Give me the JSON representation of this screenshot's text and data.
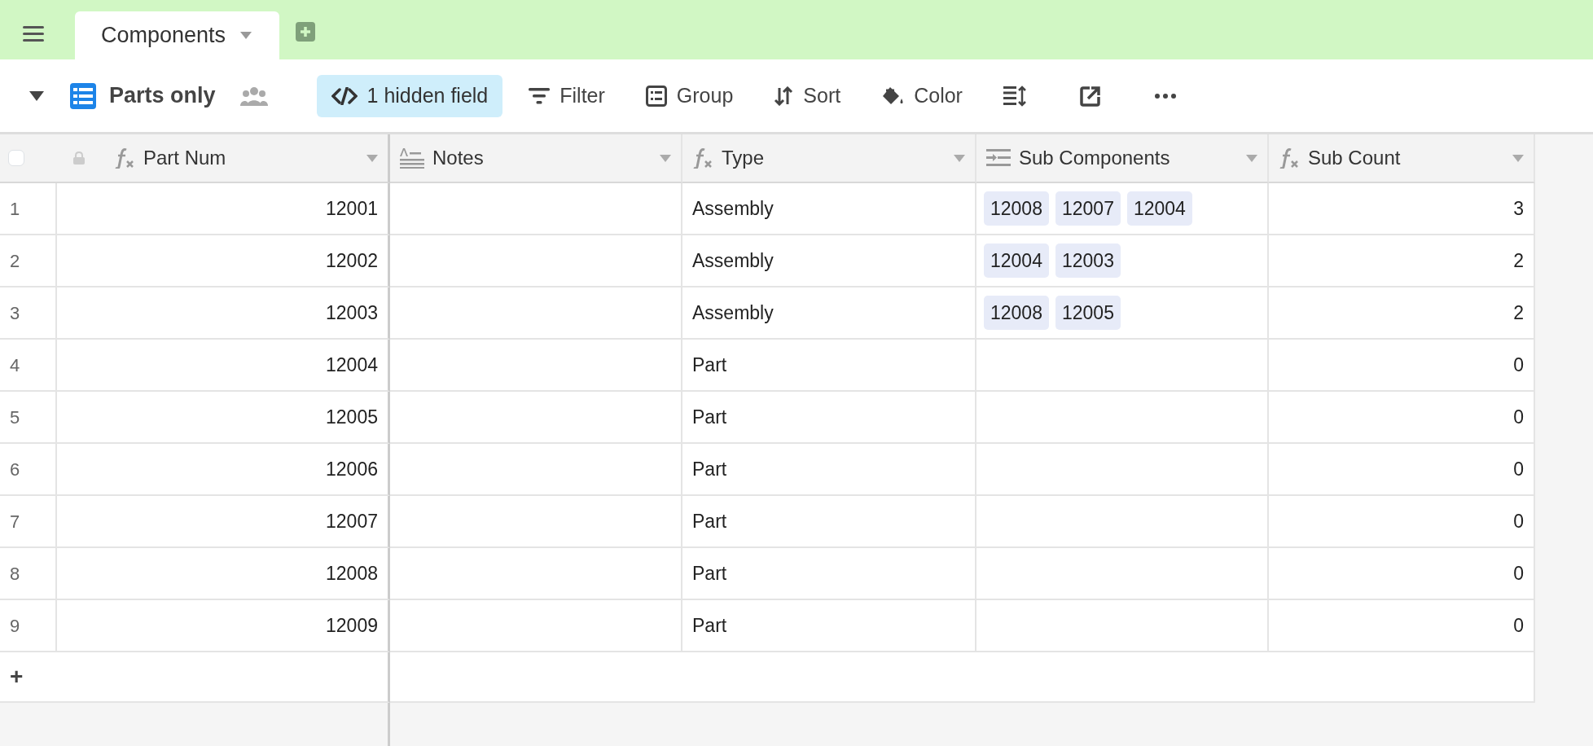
{
  "tabs": [
    {
      "label": "Components",
      "selected": true
    }
  ],
  "view": {
    "name": "Parts only"
  },
  "toolbar": [
    {
      "kind": "hidden",
      "label": "1 hidden field",
      "active": true
    },
    {
      "kind": "filter",
      "label": "Filter",
      "active": false
    },
    {
      "kind": "group",
      "label": "Group",
      "active": false
    },
    {
      "kind": "sort",
      "label": "Sort",
      "active": false
    },
    {
      "kind": "color",
      "label": "Color",
      "active": false
    },
    {
      "kind": "rowheight",
      "active": false
    },
    {
      "kind": "share",
      "active": false
    },
    {
      "kind": "more",
      "active": false
    }
  ],
  "table": {
    "select_all": {
      "checked": false
    },
    "columns": [
      {
        "name": "Part Num",
        "kind": "formula"
      },
      {
        "name": "Notes",
        "kind": "longtext"
      },
      {
        "name": "Type",
        "kind": "formula"
      },
      {
        "name": "Sub Components",
        "kind": "link"
      },
      {
        "name": "Sub Count",
        "kind": "formula"
      }
    ],
    "rows": [
      {
        "number": "1",
        "cells": [
          "12001",
          "",
          "Assembly",
          [
            "12008",
            "12007",
            "12004"
          ],
          "3"
        ]
      },
      {
        "number": "2",
        "cells": [
          "12002",
          "",
          "Assembly",
          [
            "12004",
            "12003"
          ],
          "2"
        ]
      },
      {
        "number": "3",
        "cells": [
          "12003",
          "",
          "Assembly",
          [
            "12008",
            "12005"
          ],
          "2"
        ]
      },
      {
        "number": "4",
        "cells": [
          "12004",
          "",
          "Part",
          [],
          "0"
        ]
      },
      {
        "number": "5",
        "cells": [
          "12005",
          "",
          "Part",
          [],
          "0"
        ]
      },
      {
        "number": "6",
        "cells": [
          "12006",
          "",
          "Part",
          [],
          "0"
        ]
      },
      {
        "number": "7",
        "cells": [
          "12007",
          "",
          "Part",
          [],
          "0"
        ]
      },
      {
        "number": "8",
        "cells": [
          "12008",
          "",
          "Part",
          [],
          "0"
        ]
      },
      {
        "number": "9",
        "cells": [
          "12009",
          "",
          "Part",
          [],
          "0"
        ]
      }
    ],
    "add_row": "+"
  }
}
